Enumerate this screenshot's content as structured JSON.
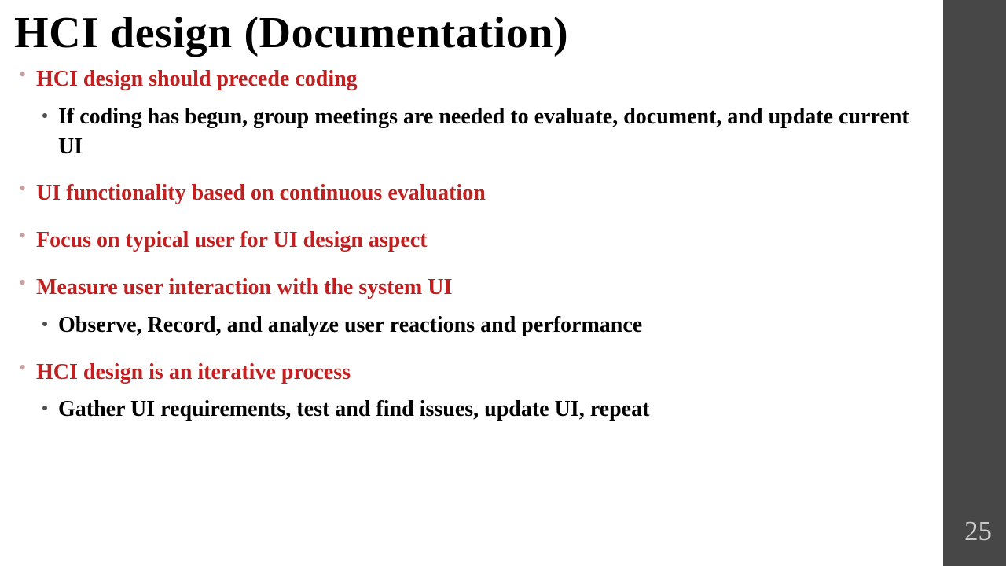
{
  "title": "HCI design (Documentation)",
  "bullets": {
    "b1": "HCI design should precede coding",
    "b1_sub": "If coding has begun, group meetings are needed to evaluate, document, and update current UI",
    "b2": "UI functionality based on continuous evaluation",
    "b3": "Focus on typical user for UI design aspect",
    "b4": "Measure user interaction with the system UI",
    "b4_sub": "Observe, Record, and analyze user reactions and performance",
    "b5": "HCI design is an iterative process",
    "b5_sub": "Gather UI requirements, test and find issues, update UI, repeat"
  },
  "page_number": "25"
}
